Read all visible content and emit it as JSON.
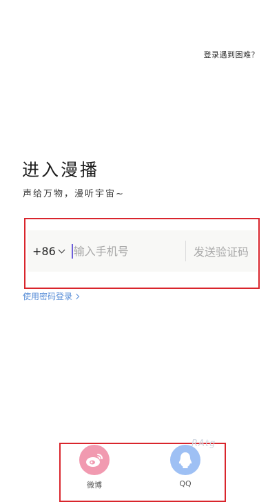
{
  "header": {
    "help_link": "登录遇到困难？"
  },
  "main": {
    "title": "进入漫播",
    "subtitle": "声给万物，漫听宇宙~",
    "phone": {
      "country_code": "+86",
      "placeholder": "输入手机号",
      "value": ""
    },
    "send_code_label": "发送验证码",
    "password_login_label": "使用密码登录"
  },
  "social": {
    "weibo_label": "微博",
    "qq_label": "QQ"
  },
  "watermark": "RAtg",
  "colors": {
    "accent_link": "#5a8fd8",
    "annotation_red": "#d9252c",
    "weibo_pink": "#f19ab0",
    "qq_blue": "#9ec0f4",
    "caret_purple": "#6d5fd9"
  }
}
